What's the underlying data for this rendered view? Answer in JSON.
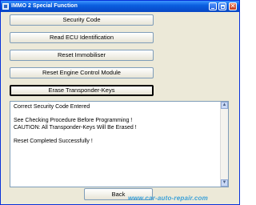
{
  "window": {
    "title": "IMMO 2 Special Function",
    "controls": {
      "minimize_icon": "minimize-icon",
      "maximize_icon": "maximize-icon",
      "close_glyph": "✕"
    }
  },
  "functions": [
    {
      "label": "Security Code",
      "selected": false
    },
    {
      "label": "Read ECU Identification",
      "selected": false
    },
    {
      "label": "Reset Immobiliser",
      "selected": false
    },
    {
      "label": "Reset Engine Control Module",
      "selected": false
    },
    {
      "label": "Erase Transponder-Keys",
      "selected": true
    }
  ],
  "log": {
    "lines": [
      "Correct Security Code Entered",
      "See Checking Procedure Before Programming !",
      "CAUTION: All Transponder-Keys Will Be Erased !",
      "Reset Completed Successfully !"
    ],
    "scroll_up_glyph": "▲",
    "scroll_down_glyph": "▼"
  },
  "footer": {
    "back_label": "Back"
  },
  "watermark": "www.car-auto-repair.com",
  "colors": {
    "title_bar": "#0a5fe0",
    "window_bg": "#ece9d8",
    "watermark": "#3aa0d8"
  }
}
